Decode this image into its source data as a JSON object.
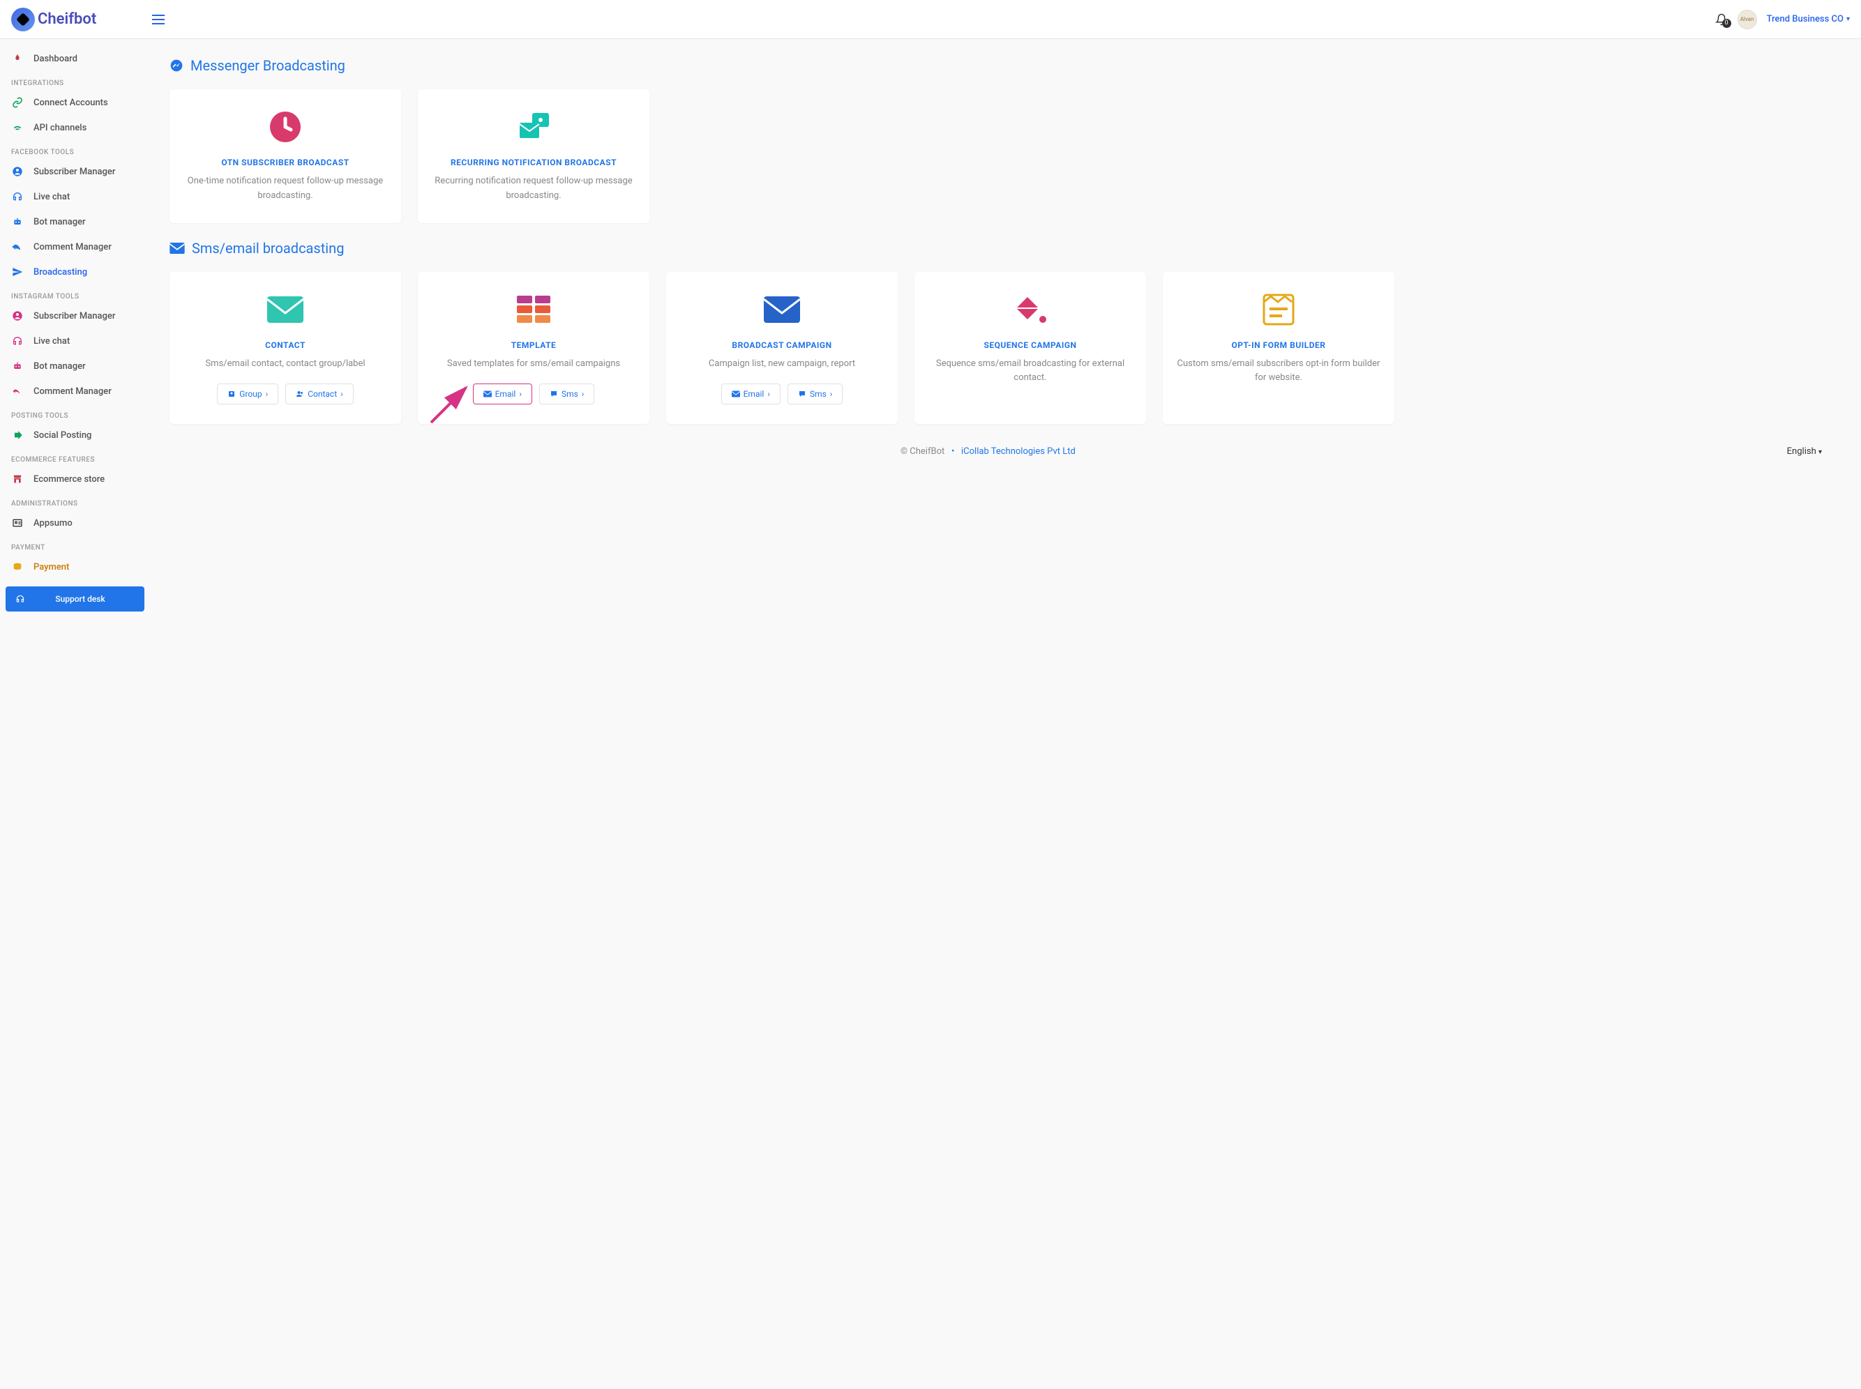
{
  "header": {
    "brand": "Cheifbot",
    "user_name": "Trend Business CO",
    "notifications_count": "0"
  },
  "sidebar": {
    "items": [
      {
        "label": "Dashboard"
      },
      {
        "label": "Connect Accounts"
      },
      {
        "label": "API channels"
      },
      {
        "label": "Subscriber Manager"
      },
      {
        "label": "Live chat"
      },
      {
        "label": "Bot manager"
      },
      {
        "label": "Comment Manager"
      },
      {
        "label": "Broadcasting"
      },
      {
        "label": "Subscriber Manager"
      },
      {
        "label": "Live chat"
      },
      {
        "label": "Bot manager"
      },
      {
        "label": "Comment Manager"
      },
      {
        "label": "Social Posting"
      },
      {
        "label": "Ecommerce store"
      },
      {
        "label": "Appsumo"
      },
      {
        "label": "Payment"
      }
    ],
    "sections": {
      "integrations": "INTEGRATIONS",
      "facebook": "FACEBOOK TOOLS",
      "instagram": "INSTAGRAM TOOLS",
      "posting": "POSTING TOOLS",
      "ecommerce": "ECOMMERCE FEATURES",
      "admin": "ADMINISTRATIONS",
      "payment": "PAYMENT"
    },
    "support": "Support desk"
  },
  "sections": {
    "messenger": "Messenger Broadcasting",
    "sms": "Sms/email broadcasting"
  },
  "cards": {
    "otn": {
      "title": "OTN SUBSCRIBER BROADCAST",
      "desc": "One-time notification request follow-up message broadcasting."
    },
    "recurring": {
      "title": "RECURRING NOTIFICATION BROADCAST",
      "desc": "Recurring notification request follow-up message broadcasting."
    },
    "contact": {
      "title": "CONTACT",
      "desc": "Sms/email contact, contact group/label",
      "btn_group": "Group",
      "btn_contact": "Contact"
    },
    "template": {
      "title": "TEMPLATE",
      "desc": "Saved templates for sms/email campaigns",
      "btn_email": "Email",
      "btn_sms": "Sms"
    },
    "campaign": {
      "title": "BROADCAST CAMPAIGN",
      "desc": "Campaign list, new campaign, report",
      "btn_email": "Email",
      "btn_sms": "Sms"
    },
    "sequence": {
      "title": "SEQUENCE CAMPAIGN",
      "desc": "Sequence sms/email broadcasting for external contact."
    },
    "optin": {
      "title": "OPT-IN FORM BUILDER",
      "desc": "Custom sms/email subscribers opt-in form builder for website."
    }
  },
  "footer": {
    "copyright": "© CheifBot",
    "dot": "•",
    "company": "iCollab Technologies Pvt Ltd",
    "lang": "English"
  }
}
